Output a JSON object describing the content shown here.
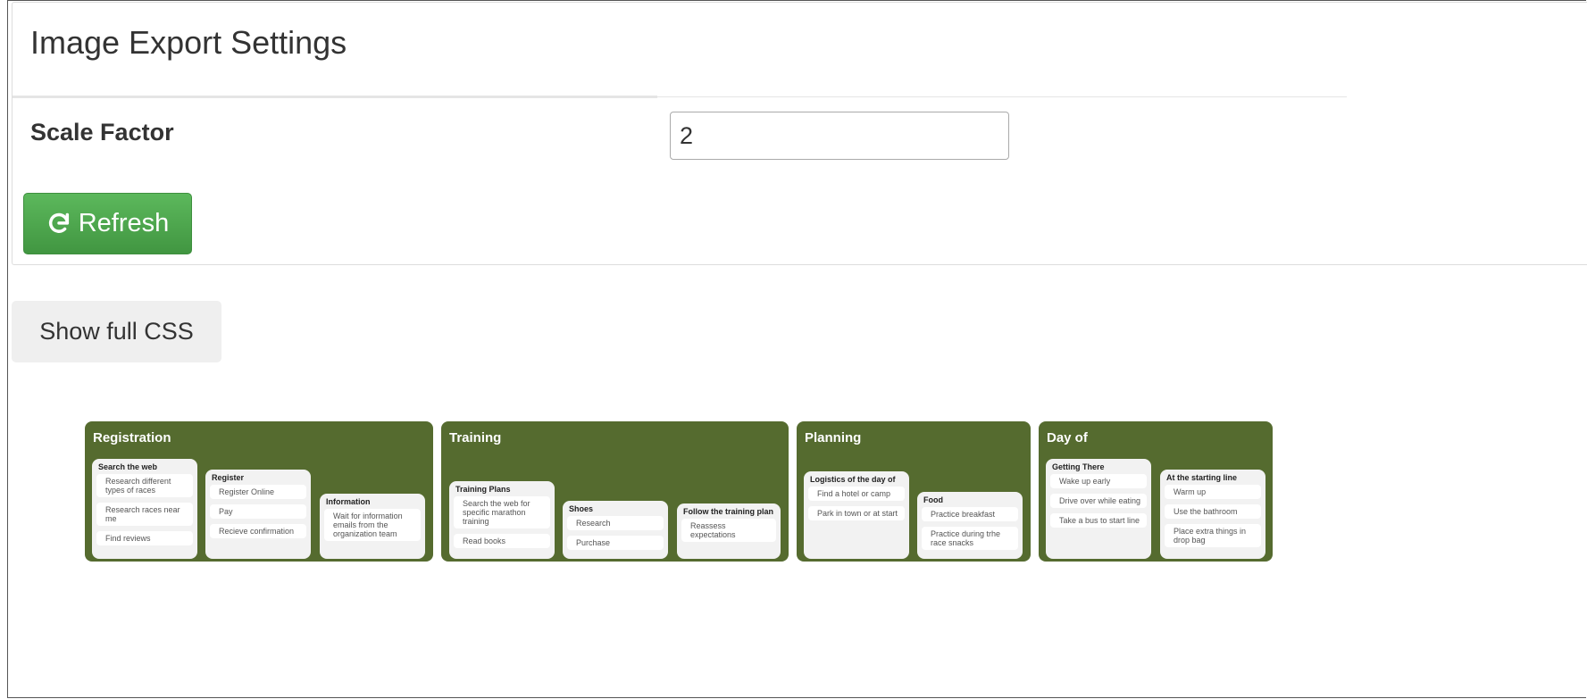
{
  "panel": {
    "title": "Image Export Settings",
    "scale_label": "Scale Factor",
    "scale_value": "2",
    "refresh_label": "Refresh"
  },
  "show_css_label": "Show full CSS",
  "board": {
    "lane_color": "#556b2f",
    "lanes": [
      {
        "title": "Registration",
        "columns": [
          {
            "title": "Search the web",
            "cards": [
              "Research different types of races",
              "Research races near me",
              "Find reviews"
            ]
          },
          {
            "title": "Register",
            "cards": [
              "Register Online",
              "Pay",
              "Recieve confirmation"
            ]
          },
          {
            "title": "Information",
            "cards": [
              "Wait for information emails from the organization team"
            ]
          }
        ]
      },
      {
        "title": "Training",
        "columns": [
          {
            "title": "Training Plans",
            "cards": [
              "Search the web for specific marathon training",
              "Read books"
            ]
          },
          {
            "title": "Shoes",
            "cards": [
              "Research",
              "Purchase"
            ]
          },
          {
            "title": "Follow the training plan",
            "cards": [
              "Reassess expectations"
            ]
          }
        ]
      },
      {
        "title": "Planning",
        "columns": [
          {
            "title": "Logistics of the day of",
            "cards": [
              "Find a hotel or camp",
              "Park in town or at start"
            ]
          },
          {
            "title": "Food",
            "cards": [
              "Practice breakfast",
              "Practice during trhe race snacks"
            ]
          }
        ]
      },
      {
        "title": "Day of",
        "columns": [
          {
            "title": "Getting There",
            "cards": [
              "Wake up early",
              "Drive over while eating",
              "Take a bus to start line"
            ]
          },
          {
            "title": "At the starting line",
            "cards": [
              "Warm up",
              "Use the bathroom",
              "Place extra things in drop bag"
            ]
          }
        ]
      }
    ]
  }
}
